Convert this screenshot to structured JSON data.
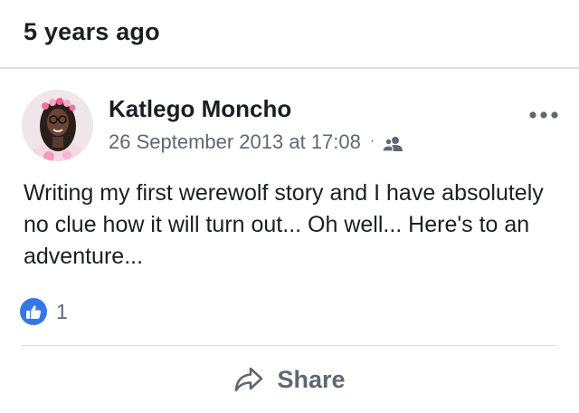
{
  "memory": {
    "title": "5 years ago"
  },
  "post": {
    "author": "Katlego Moncho",
    "date": "26 September 2013 at 17:08",
    "separator": "·",
    "audience_icon": "friends-icon",
    "text": "Writing my first werewolf story and I have absolutely no clue how it will turn out... Oh well... Here's to an adventure...",
    "reactions": {
      "icon": "like-icon",
      "count": "1"
    },
    "actions": {
      "share_label": "Share",
      "share_icon": "share-arrow-icon",
      "more_icon": "more-options-icon"
    }
  },
  "colors": {
    "like_blue": "#3578e5",
    "secondary_text": "#606770",
    "primary_text": "#1c1e21",
    "divider": "#dadde1"
  }
}
